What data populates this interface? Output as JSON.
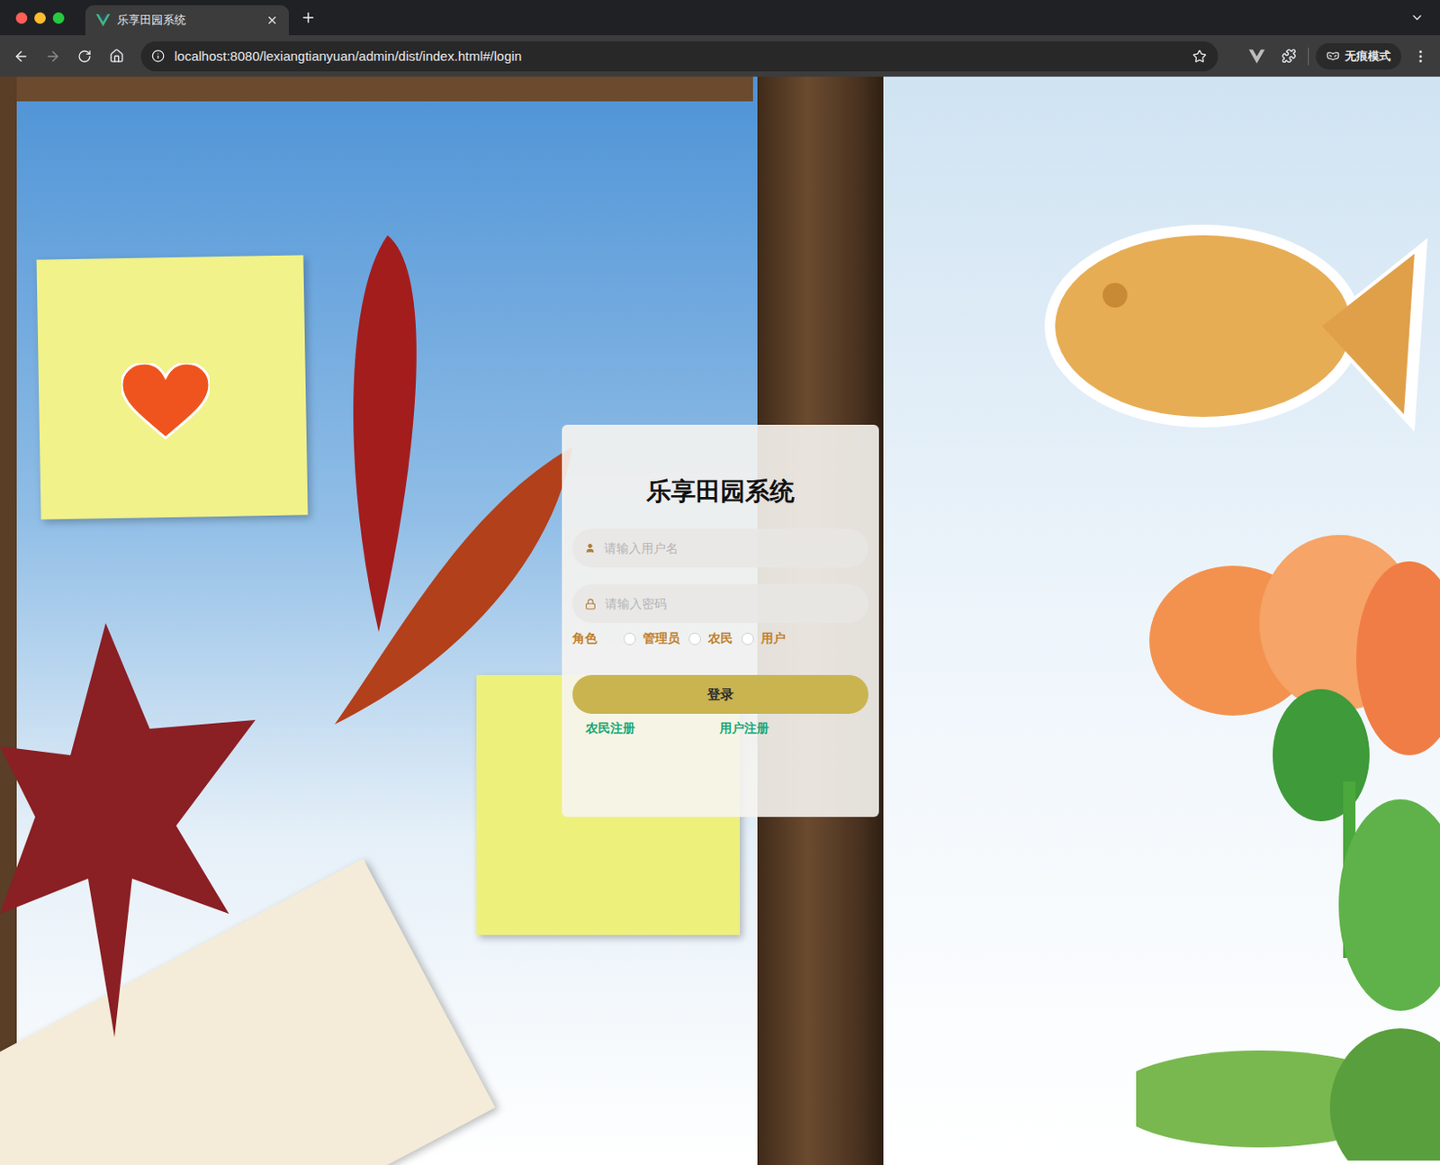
{
  "browser": {
    "tabs": [
      {
        "title": "乐享田园系统",
        "selected": true
      }
    ],
    "url": "localhost:8080/lexiangtianyuan/admin/dist/index.html#/login",
    "incognito": "无痕模式"
  },
  "login": {
    "title": "乐享田园系统",
    "username_placeholder": "请输入用户名",
    "password_placeholder": "请输入密码",
    "role_label": "角色",
    "roles": [
      {
        "label": "管理员",
        "selected": false
      },
      {
        "label": "农民",
        "selected": false
      },
      {
        "label": "用户",
        "selected": false
      }
    ],
    "submit": "登录",
    "links": [
      "农民注册",
      "用户注册"
    ]
  }
}
